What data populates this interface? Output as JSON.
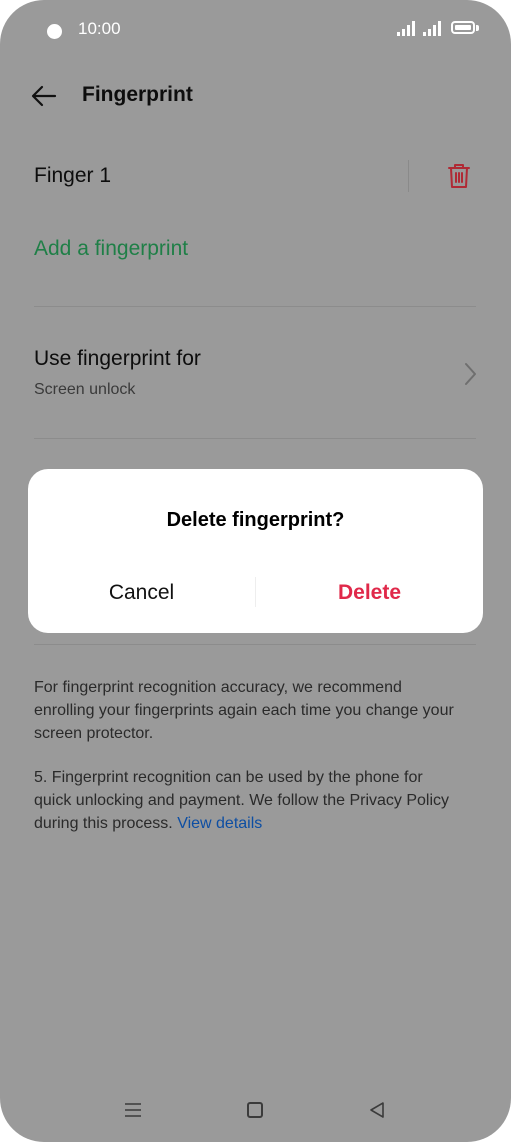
{
  "status_bar": {
    "time": "10:00"
  },
  "header": {
    "title": "Fingerprint"
  },
  "fingerprint": {
    "name": "Finger 1"
  },
  "add_fingerprint": "Add a fingerprint",
  "use_for": {
    "title": "Use fingerprint for",
    "subtitle": "Screen unlock"
  },
  "dialog": {
    "title": "Delete fingerprint?",
    "cancel_label": "Cancel",
    "delete_label": "Delete"
  },
  "notes": {
    "recommendation": "For fingerprint recognition accuracy, we recommend enrolling your fingerprints again each time you change your screen protector.",
    "privacy_text": "5. Fingerprint recognition can be used by the phone for quick unlocking and payment. We follow the Privacy Policy during this process.",
    "privacy_link": "View details"
  },
  "colors": {
    "overlay": "#9a9a9a",
    "accent_green": "#1f7f47",
    "danger_red": "#e0294a",
    "link_blue": "#0d4ea3"
  },
  "icons": [
    "back-arrow-icon",
    "trash-icon",
    "chevron-right-icon",
    "signal-icon",
    "battery-icon",
    "menu-icon",
    "home-icon",
    "back-triangle-icon"
  ]
}
